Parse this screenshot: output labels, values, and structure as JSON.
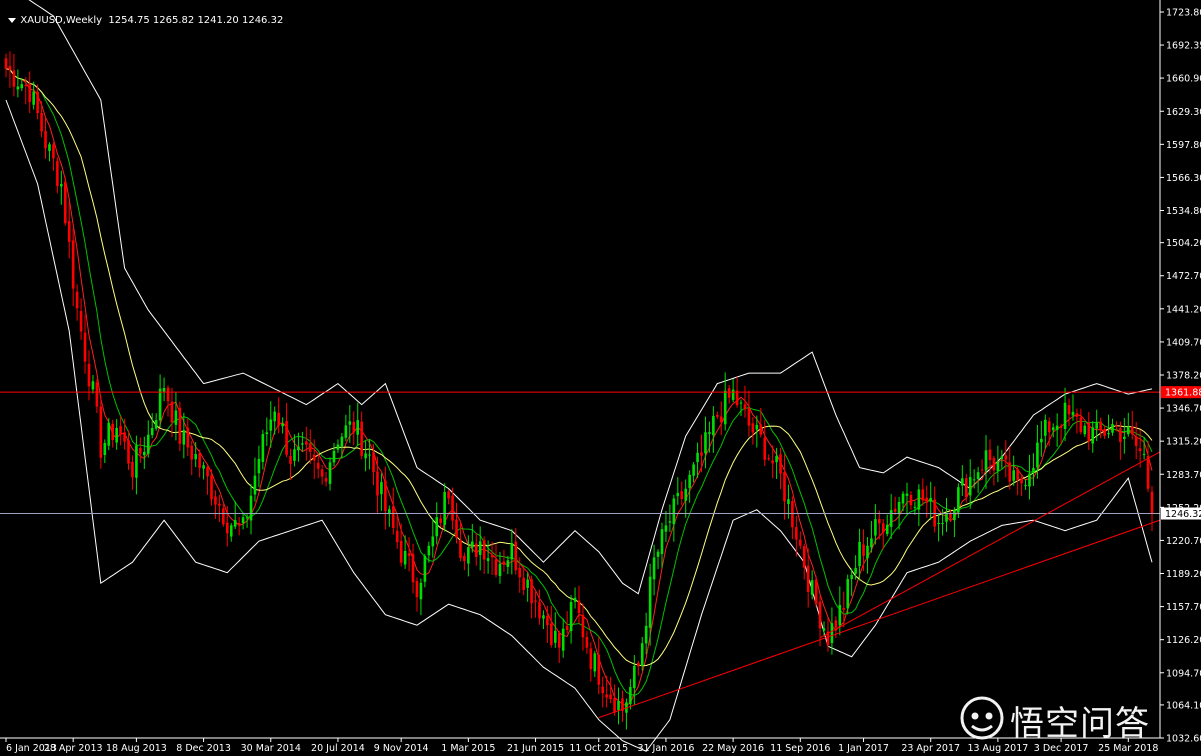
{
  "header": {
    "symbol": "XAUUSD,Weekly",
    "ohlc": "1254.75 1265.82 1241.20 1246.32"
  },
  "watermark": {
    "text": "悟空问答",
    "icon": "wukong-logo-icon"
  },
  "colors": {
    "background": "#000000",
    "bull": "#00e000",
    "bear": "#ff0000",
    "bands": "#ffffff",
    "ma_fast": "#ff2020",
    "ma_mid": "#00c000",
    "ma_slow": "#ffff80",
    "hline": "#ff0000",
    "current_line": "#a0a0c0"
  },
  "chart_data": {
    "type": "candlestick",
    "title": "XAUUSD,Weekly",
    "y_ticks": [
      "1723.80",
      "1692.35",
      "1660.90",
      "1629.30",
      "1597.80",
      "1566.30",
      "1534.80",
      "1504.20",
      "1472.70",
      "1441.20",
      "1409.70",
      "1378.20",
      "1346.70",
      "1315.20",
      "1283.70",
      "1252.20",
      "1220.70",
      "1189.20",
      "1157.70",
      "1126.20",
      "1094.70",
      "1064.10",
      "1032.60"
    ],
    "ylim": [
      1032.6,
      1723.8
    ],
    "x_ticks": [
      "6 Jan 2013",
      "28 Apr 2013",
      "18 Aug 2013",
      "8 Dec 2013",
      "30 Mar 2014",
      "20 Jul 2014",
      "9 Nov 2014",
      "1 Mar 2015",
      "21 Jun 2015",
      "11 Oct 2015",
      "31 Jan 2016",
      "22 May 2016",
      "11 Sep 2016",
      "1 Jan 2017",
      "23 Apr 2017",
      "13 Aug 2017",
      "3 Dec 2017",
      "25 Mar 2018"
    ],
    "horizontal_line": {
      "value": 1361.88,
      "label": "1361.88"
    },
    "current_price": {
      "value": 1246.32,
      "label": "1246.32"
    },
    "close_path": [
      [
        0,
        1670
      ],
      [
        6,
        1650
      ],
      [
        10,
        1600
      ],
      [
        14,
        1560
      ],
      [
        18,
        1440
      ],
      [
        22,
        1360
      ],
      [
        24,
        1310
      ],
      [
        28,
        1330
      ],
      [
        32,
        1290
      ],
      [
        36,
        1320
      ],
      [
        40,
        1370
      ],
      [
        44,
        1320
      ],
      [
        48,
        1300
      ],
      [
        52,
        1270
      ],
      [
        56,
        1240
      ],
      [
        60,
        1230
      ],
      [
        64,
        1300
      ],
      [
        68,
        1350
      ],
      [
        72,
        1300
      ],
      [
        76,
        1300
      ],
      [
        80,
        1280
      ],
      [
        84,
        1320
      ],
      [
        88,
        1330
      ],
      [
        92,
        1300
      ],
      [
        96,
        1250
      ],
      [
        100,
        1210
      ],
      [
        104,
        1180
      ],
      [
        108,
        1220
      ],
      [
        112,
        1270
      ],
      [
        116,
        1200
      ],
      [
        120,
        1220
      ],
      [
        124,
        1200
      ],
      [
        128,
        1210
      ],
      [
        132,
        1180
      ],
      [
        136,
        1150
      ],
      [
        140,
        1120
      ],
      [
        144,
        1160
      ],
      [
        148,
        1110
      ],
      [
        152,
        1080
      ],
      [
        156,
        1060
      ],
      [
        160,
        1100
      ],
      [
        164,
        1200
      ],
      [
        168,
        1240
      ],
      [
        172,
        1270
      ],
      [
        176,
        1300
      ],
      [
        180,
        1340
      ],
      [
        184,
        1360
      ],
      [
        188,
        1330
      ],
      [
        192,
        1310
      ],
      [
        196,
        1280
      ],
      [
        200,
        1230
      ],
      [
        204,
        1170
      ],
      [
        208,
        1130
      ],
      [
        212,
        1160
      ],
      [
        216,
        1210
      ],
      [
        220,
        1230
      ],
      [
        224,
        1250
      ],
      [
        228,
        1270
      ],
      [
        232,
        1260
      ],
      [
        236,
        1240
      ],
      [
        240,
        1260
      ],
      [
        244,
        1280
      ],
      [
        248,
        1300
      ],
      [
        252,
        1290
      ],
      [
        256,
        1270
      ],
      [
        260,
        1300
      ],
      [
        264,
        1330
      ],
      [
        268,
        1340
      ],
      [
        272,
        1330
      ],
      [
        276,
        1320
      ],
      [
        280,
        1330
      ],
      [
        284,
        1320
      ],
      [
        288,
        1300
      ],
      [
        290,
        1246.32
      ]
    ],
    "n_bars": 291,
    "bollinger_upper": [
      [
        0,
        1750
      ],
      [
        12,
        1720
      ],
      [
        24,
        1640
      ],
      [
        30,
        1480
      ],
      [
        36,
        1440
      ],
      [
        44,
        1400
      ],
      [
        50,
        1370
      ],
      [
        60,
        1380
      ],
      [
        68,
        1365
      ],
      [
        76,
        1350
      ],
      [
        84,
        1370
      ],
      [
        90,
        1350
      ],
      [
        96,
        1370
      ],
      [
        104,
        1290
      ],
      [
        112,
        1270
      ],
      [
        120,
        1240
      ],
      [
        128,
        1230
      ],
      [
        136,
        1200
      ],
      [
        144,
        1230
      ],
      [
        150,
        1210
      ],
      [
        156,
        1180
      ],
      [
        160,
        1170
      ],
      [
        166,
        1250
      ],
      [
        172,
        1320
      ],
      [
        180,
        1370
      ],
      [
        188,
        1380
      ],
      [
        196,
        1380
      ],
      [
        204,
        1400
      ],
      [
        210,
        1340
      ],
      [
        216,
        1290
      ],
      [
        222,
        1285
      ],
      [
        228,
        1300
      ],
      [
        236,
        1290
      ],
      [
        244,
        1270
      ],
      [
        252,
        1300
      ],
      [
        260,
        1340
      ],
      [
        268,
        1360
      ],
      [
        276,
        1370
      ],
      [
        284,
        1360
      ],
      [
        290,
        1365
      ]
    ],
    "bollinger_lower": [
      [
        0,
        1640
      ],
      [
        8,
        1560
      ],
      [
        16,
        1420
      ],
      [
        24,
        1180
      ],
      [
        32,
        1200
      ],
      [
        40,
        1240
      ],
      [
        48,
        1200
      ],
      [
        56,
        1190
      ],
      [
        64,
        1220
      ],
      [
        72,
        1230
      ],
      [
        80,
        1240
      ],
      [
        88,
        1190
      ],
      [
        96,
        1150
      ],
      [
        104,
        1140
      ],
      [
        112,
        1160
      ],
      [
        120,
        1150
      ],
      [
        128,
        1130
      ],
      [
        136,
        1100
      ],
      [
        144,
        1080
      ],
      [
        150,
        1050
      ],
      [
        156,
        1030
      ],
      [
        162,
        1020
      ],
      [
        168,
        1050
      ],
      [
        176,
        1150
      ],
      [
        184,
        1240
      ],
      [
        190,
        1250
      ],
      [
        196,
        1230
      ],
      [
        202,
        1200
      ],
      [
        208,
        1120
      ],
      [
        214,
        1110
      ],
      [
        220,
        1140
      ],
      [
        228,
        1190
      ],
      [
        236,
        1200
      ],
      [
        244,
        1220
      ],
      [
        252,
        1235
      ],
      [
        260,
        1240
      ],
      [
        268,
        1230
      ],
      [
        276,
        1240
      ],
      [
        284,
        1280
      ],
      [
        290,
        1200
      ]
    ],
    "trendlines": [
      {
        "from": [
          150,
          1052
        ],
        "to": [
          290,
          1240
        ]
      },
      {
        "from": [
          206,
          1128
        ],
        "to": [
          290,
          1305
        ]
      }
    ]
  }
}
